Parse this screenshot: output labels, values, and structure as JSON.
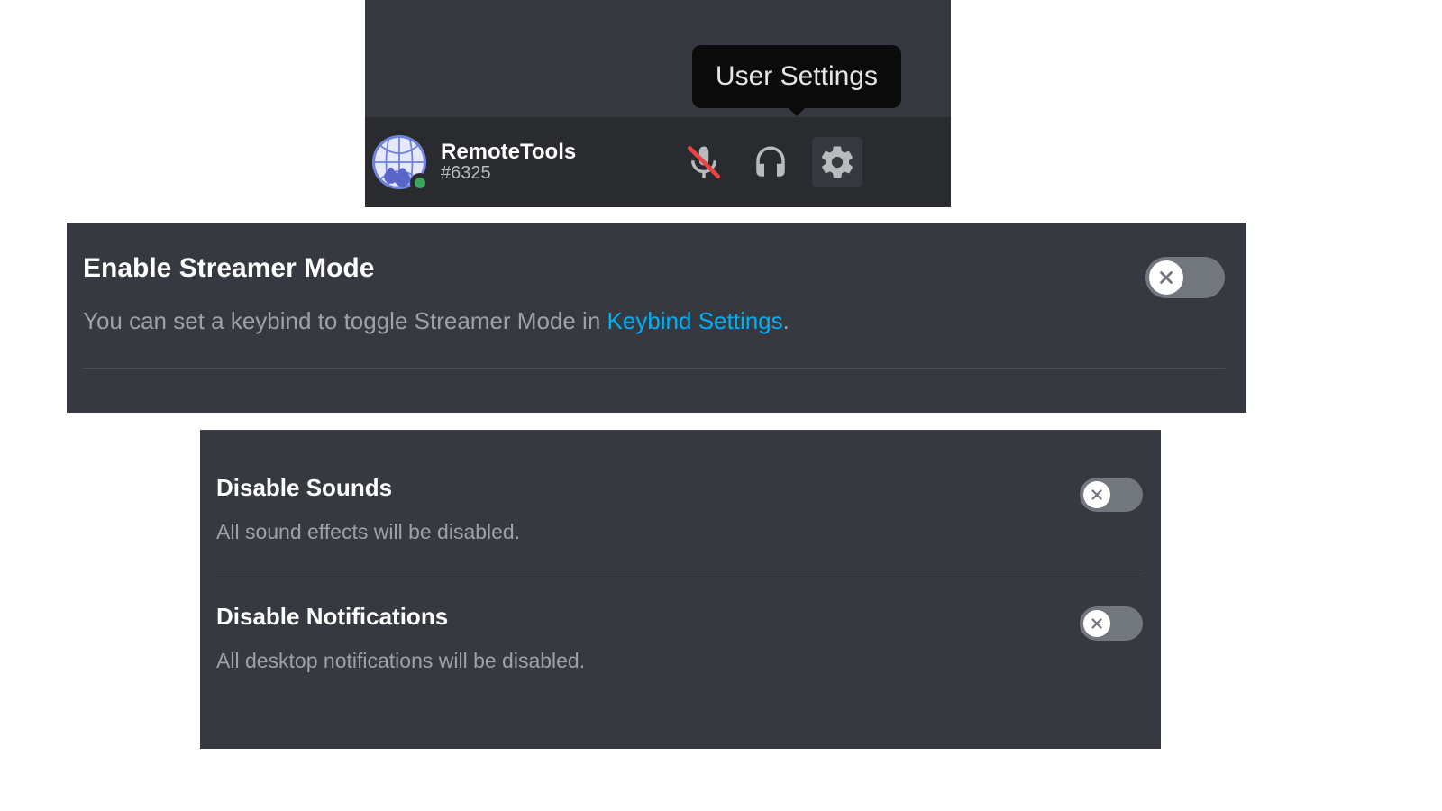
{
  "tooltip": {
    "label": "User Settings"
  },
  "user": {
    "name": "RemoteTools",
    "discriminator": "#6325",
    "status": "online"
  },
  "icons": {
    "mic": "mic-muted-icon",
    "deafen": "headphones-icon",
    "settings": "gear-icon"
  },
  "streamer_mode": {
    "title": "Enable Streamer Mode",
    "desc_prefix": "You can set a keybind to toggle Streamer Mode in ",
    "link_text": "Keybind Settings",
    "desc_suffix": ".",
    "enabled": false
  },
  "options": [
    {
      "title": "Disable Sounds",
      "desc": "All sound effects will be disabled.",
      "enabled": false
    },
    {
      "title": "Disable Notifications",
      "desc": "All desktop notifications will be disabled.",
      "enabled": false
    }
  ],
  "colors": {
    "bg_panel": "#36393f",
    "bg_bar": "#292b2f",
    "link": "#00aff4",
    "toggle_off": "#72767d",
    "status_online": "#3ba55c"
  }
}
